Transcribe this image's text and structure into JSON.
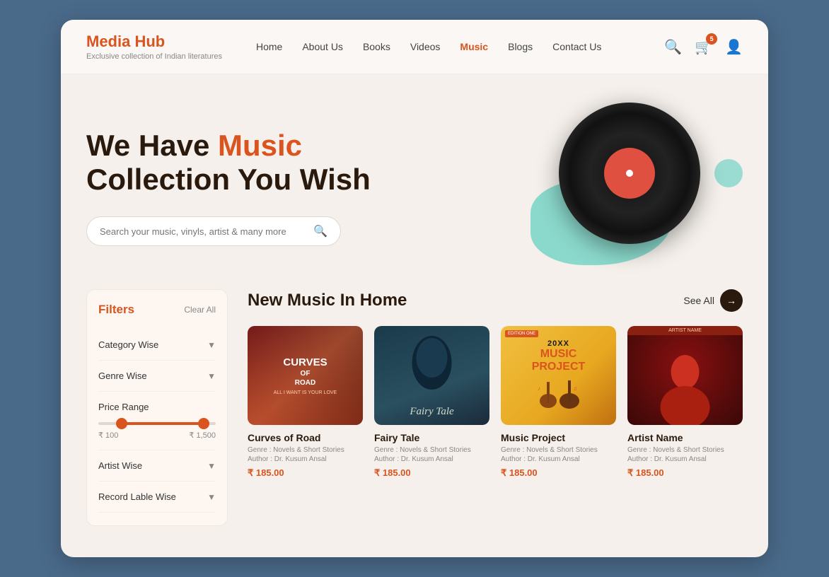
{
  "brand": {
    "name": "Media Hub",
    "tagline": "Exclusive collection of Indian literatures"
  },
  "nav": {
    "items": [
      {
        "label": "Home",
        "active": false
      },
      {
        "label": "About Us",
        "active": false
      },
      {
        "label": "Books",
        "active": false
      },
      {
        "label": "Videos",
        "active": false
      },
      {
        "label": "Music",
        "active": true
      },
      {
        "label": "Blogs",
        "active": false
      },
      {
        "label": "Contact Us",
        "active": false
      }
    ]
  },
  "header_actions": {
    "cart_count": "5"
  },
  "hero": {
    "title_part1": "We Have ",
    "title_highlight": "Music",
    "title_part2": "Collection You Wish",
    "search_placeholder": "Search your music, vinyls, artist & many more"
  },
  "filters": {
    "title": "Filters",
    "clear_label": "Clear All",
    "items": [
      {
        "label": "Category Wise"
      },
      {
        "label": "Genre Wise"
      }
    ],
    "price_range": {
      "label": "Price Range",
      "min": "₹ 100",
      "max": "₹ 1,500"
    },
    "bottom_items": [
      {
        "label": "Artist Wise"
      },
      {
        "label": "Record Lable Wise"
      }
    ]
  },
  "section": {
    "title": "New Music In Home",
    "see_all": "See All"
  },
  "products": [
    {
      "name": "Curves of Road",
      "cover_type": "curves",
      "genre": "Genre : Novels & Short Stories",
      "author": "Author : Dr. Kusum Ansal",
      "price": "₹ 185.00"
    },
    {
      "name": "Fairy Tale",
      "cover_type": "fairy",
      "genre": "Genre : Novels & Short Stories",
      "author": "Author : Dr. Kusum Ansal",
      "price": "₹ 185.00"
    },
    {
      "name": "Music Project",
      "cover_type": "music",
      "genre": "Genre : Novels & Short Stories",
      "author": "Author : Dr. Kusum Ansal",
      "price": "₹ 185.00"
    },
    {
      "name": "Artist Name",
      "cover_type": "artist",
      "genre": "Genre : Novels & Short Stories",
      "author": "Author : Dr. Kusum Ansal",
      "price": "₹ 185.00"
    }
  ]
}
